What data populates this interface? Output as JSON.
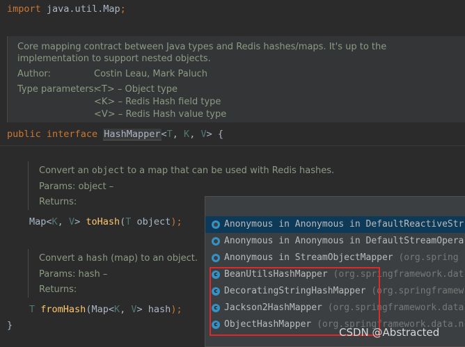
{
  "import_line": {
    "keyword": "import",
    "path": "java.util.Map",
    "semi": ";"
  },
  "class_doc": {
    "summary": "Core mapping contract between Java types and Redis hashes/maps. It's up to the implementation to support nested objects.",
    "author_label": "Author:",
    "author_value": "Costin Leau, Mark Paluch",
    "type_params_label": "Type parameters:",
    "type_params": [
      "<T> – Object type",
      "<K> – Redis Hash field type",
      "<V> – Redis Hash value type"
    ]
  },
  "interface_decl": {
    "kw_public": "public",
    "kw_interface": "interface",
    "name": "HashMapper",
    "lt": "<",
    "t": "T",
    "comma1": ", ",
    "k": "K",
    "comma2": ", ",
    "v": "V",
    "gt": "> {"
  },
  "to_hash_doc": {
    "pre": "Convert an ",
    "code": "object",
    "post": " to a map that can be used with Redis hashes.",
    "params": "Params:  object –",
    "returns": "Returns:"
  },
  "to_hash_sig": {
    "ret_map": "Map",
    "lt": "<",
    "k": "K",
    "comma": ", ",
    "v": "V",
    "gt": "> ",
    "name": "toHash",
    "open": "(",
    "param_type": "T",
    "param_name": " object",
    "close": ");"
  },
  "from_hash_doc": {
    "pre": "Convert a ",
    "code": "hash",
    "post": " (map) to an object.",
    "params": "Params:  hash –",
    "returns": "Returns:"
  },
  "from_hash_sig": {
    "ret": "T",
    "name": "fromHash",
    "open": "(",
    "map": "Map",
    "lt": "<",
    "k": "K",
    "comma": ", ",
    "v": "V",
    "gt": ">",
    "param_name": " hash",
    "close": ");"
  },
  "closing_brace": "}",
  "completion_popup": {
    "items": [
      {
        "icon": "anonymous-class-icon",
        "name": "Anonymous in Anonymous in DefaultReactiveStr",
        "pkg": "",
        "selected": true
      },
      {
        "icon": "anonymous-class-icon",
        "name": "Anonymous in Anonymous in DefaultStreamOpera",
        "pkg": "",
        "selected": false
      },
      {
        "icon": "anonymous-class-icon",
        "name": "Anonymous in StreamObjectMapper ",
        "pkg": "(org.spring",
        "selected": false
      },
      {
        "icon": "class-icon",
        "name": "BeanUtilsHashMapper ",
        "pkg": "(org.springframework.dat",
        "selected": false
      },
      {
        "icon": "class-icon",
        "name": "DecoratingStringHashMapper ",
        "pkg": "(org.springframew",
        "selected": false
      },
      {
        "icon": "class-icon",
        "name": "Jackson2HashMapper ",
        "pkg": "(org.springframework.data.",
        "selected": false
      },
      {
        "icon": "class-icon",
        "name": "ObjectHashMapper ",
        "pkg": "(org.springframework.data.n",
        "selected": false
      }
    ],
    "class_icon_letter": "c"
  },
  "watermark": "CSDN @Abstracted",
  "colors": {
    "background": "#2b2b2b",
    "keyword": "#cc7832",
    "function": "#ffc66d",
    "type_param": "#507874",
    "doc_text": "#8c9b84",
    "popup_selected": "#0d3a58",
    "highlight_box": "#e02a2a"
  }
}
